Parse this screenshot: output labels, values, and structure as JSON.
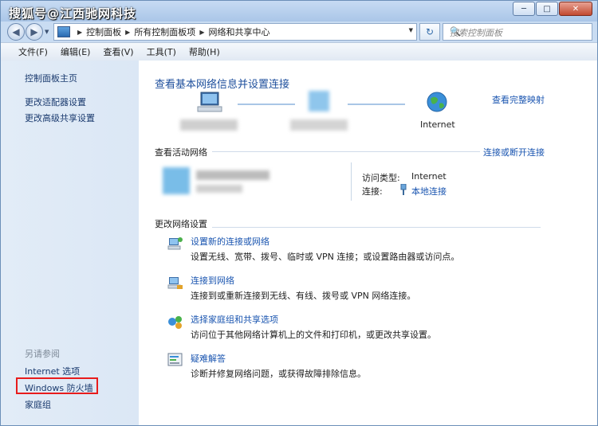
{
  "watermark": "搜狐号@江西驰网科技",
  "window_buttons": {
    "minimize": "─",
    "maximize": "□",
    "close": "✕"
  },
  "nav": {
    "back": "◀",
    "forward": "▶",
    "dropdown": "▼",
    "refresh": "↻"
  },
  "address": {
    "crumbs": [
      "控制面板",
      "所有控制面板项",
      "网络和共享中心"
    ],
    "separator": "▶"
  },
  "search": {
    "placeholder": "搜索控制面板",
    "icon": "🔍"
  },
  "menu": [
    "文件(F)",
    "编辑(E)",
    "查看(V)",
    "工具(T)",
    "帮助(H)"
  ],
  "sidebar": {
    "home": "控制面板主页",
    "adapter": "更改适配器设置",
    "sharing": "更改高级共享设置",
    "see_also": "另请参阅",
    "see_also_items": [
      "Internet 选项",
      "Windows 防火墙",
      "家庭组"
    ]
  },
  "content": {
    "title": "查看基本网络信息并设置连接",
    "full_map": "查看完整映射",
    "internet_label": "Internet",
    "active_networks": "查看活动网络",
    "connect_disconnect": "连接或断开连接",
    "access_type_label": "访问类型:",
    "access_type_value": "Internet",
    "connection_label": "连接:",
    "connection_value": "本地连接",
    "change_settings": "更改网络设置",
    "tasks": [
      {
        "title": "设置新的连接或网络",
        "desc": "设置无线、宽带、拨号、临时或 VPN 连接；或设置路由器或访问点。"
      },
      {
        "title": "连接到网络",
        "desc": "连接到或重新连接到无线、有线、拨号或 VPN 网络连接。"
      },
      {
        "title": "选择家庭组和共享选项",
        "desc": "访问位于其他网络计算机上的文件和打印机，或更改共享设置。"
      },
      {
        "title": "疑难解答",
        "desc": "诊断并修复网络问题，或获得故障排除信息。"
      }
    ]
  }
}
